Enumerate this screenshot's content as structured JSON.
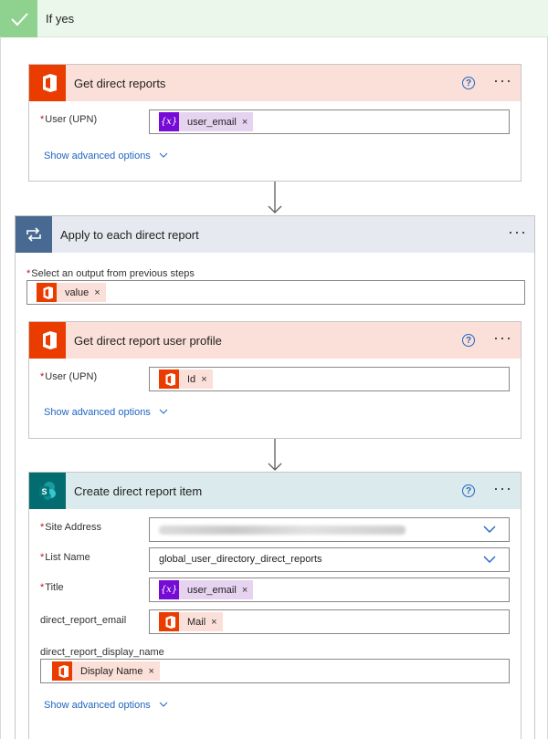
{
  "condition": {
    "title": "If yes"
  },
  "get_direct_reports": {
    "title": "Get direct reports",
    "user_label": "User (UPN)",
    "user_token": "user_email",
    "advanced": "Show advanced options"
  },
  "apply_each": {
    "title": "Apply to each direct report",
    "select_label": "Select an output from previous steps",
    "select_token": "value"
  },
  "get_profile": {
    "title": "Get direct report user profile",
    "user_label": "User (UPN)",
    "user_token": "Id",
    "advanced": "Show advanced options"
  },
  "create_item": {
    "title": "Create direct report item",
    "site_label": "Site Address",
    "list_label": "List Name",
    "list_value": "global_user_directory_direct_reports",
    "title_label": "Title",
    "title_token": "user_email",
    "email_label": "direct_report_email",
    "email_token": "Mail",
    "display_label": "direct_report_display_name",
    "display_token": "Display Name",
    "advanced": "Show advanced options"
  },
  "common": {
    "required_mark": "*",
    "remove_mark": "×",
    "var_glyph": "{x}",
    "more": "···"
  },
  "colors": {
    "office": "#eb3c00",
    "variable": "#770bd6",
    "loop": "#486991",
    "sharepoint": "#036c70",
    "link": "#2266c0"
  }
}
